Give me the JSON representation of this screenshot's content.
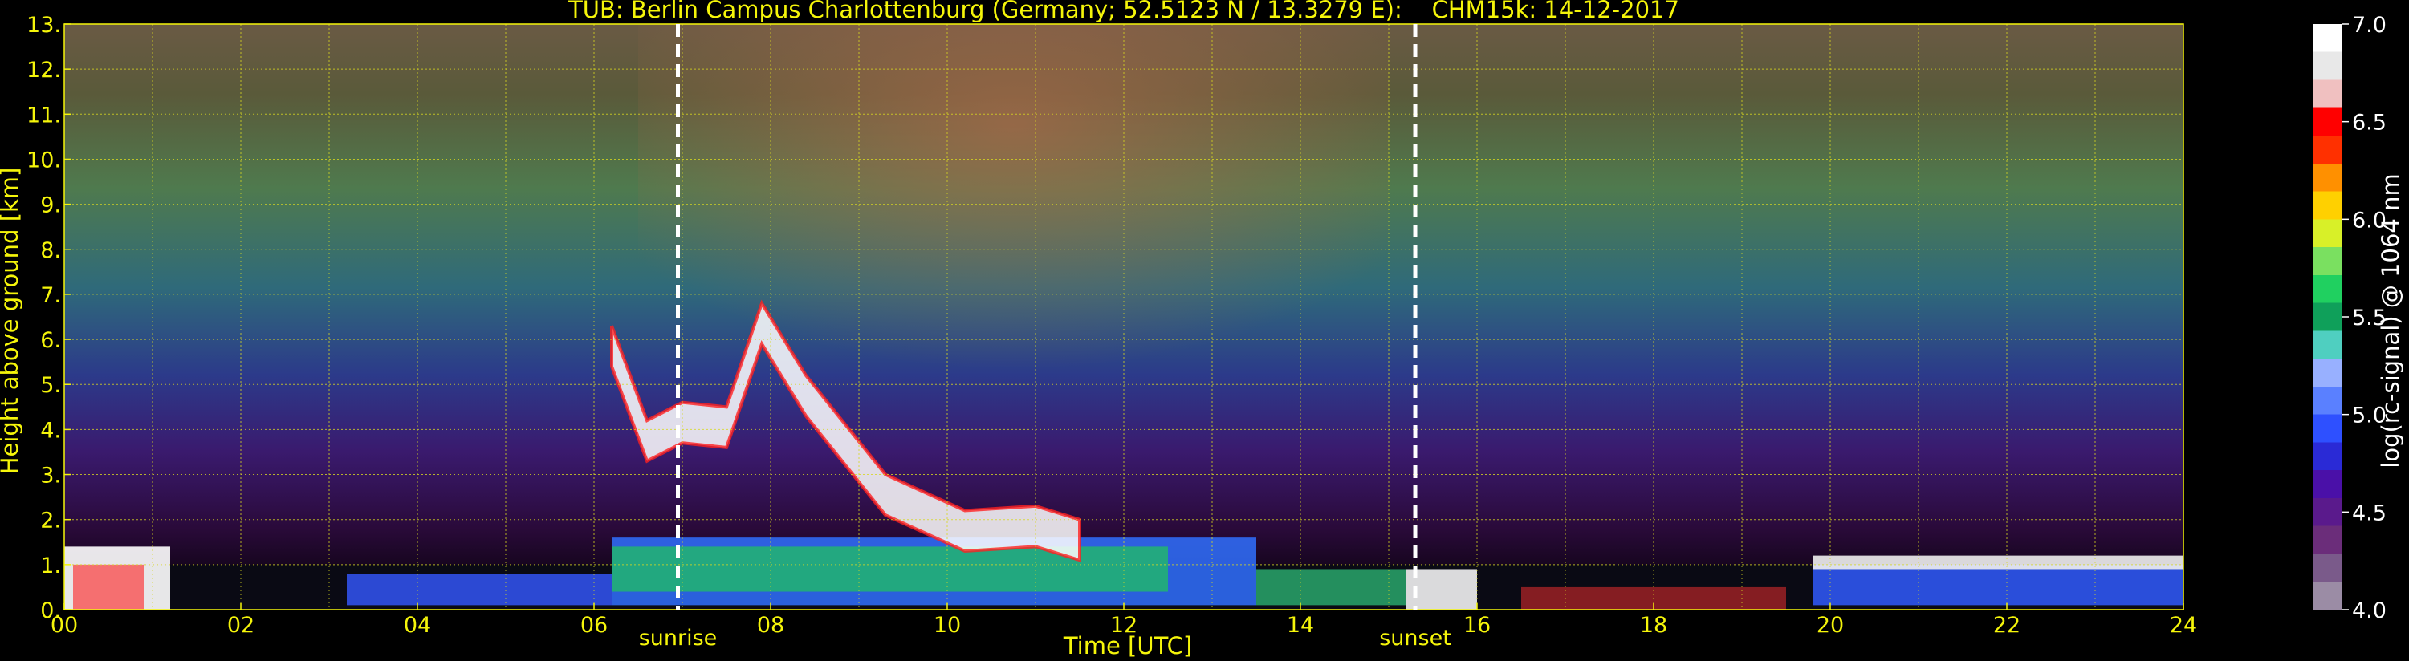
{
  "chart_data": {
    "type": "heatmap",
    "title": "TUB: Berlin Campus Charlottenburg (Germany; 52.5123 N / 13.3279 E):    CHM15k: 14-12-2017",
    "xlabel": "Time [UTC]",
    "ylabel": "Height above ground [km]",
    "colorbar_label": "log(rc-signal) @ 1064 nm",
    "x_ticks": [
      "00",
      "02",
      "04",
      "06",
      "08",
      "10",
      "12",
      "14",
      "16",
      "18",
      "20",
      "22",
      "24"
    ],
    "y_ticks": [
      "0.",
      "1.",
      "2.",
      "3.",
      "4.",
      "5.",
      "6.",
      "7.",
      "8.",
      "9.",
      "10.",
      "11.",
      "12.",
      "13."
    ],
    "cbar_ticks": [
      "4.0",
      "4.5",
      "5.0",
      "5.5",
      "6.0",
      "6.5",
      "7.0"
    ],
    "xlim": [
      0,
      24
    ],
    "ylim": [
      0,
      13
    ],
    "clim": [
      4.0,
      7.0
    ],
    "grid": true,
    "markers": [
      {
        "label": "sunrise",
        "time": 6.95
      },
      {
        "label": "sunset",
        "time": 15.3
      }
    ],
    "colors": [
      "#9b8ca5",
      "#7a5a8a",
      "#6b2d7a",
      "#5a1a8c",
      "#4a10a8",
      "#2a2ad6",
      "#2e50ff",
      "#5a80ff",
      "#98b0ff",
      "#4fcfc0",
      "#0fa05a",
      "#20d060",
      "#7ae060",
      "#d8f028",
      "#ffd000",
      "#ff9000",
      "#ff3000",
      "#ff0000",
      "#f0c0c0",
      "#e8e8e8",
      "#ffffff"
    ]
  }
}
